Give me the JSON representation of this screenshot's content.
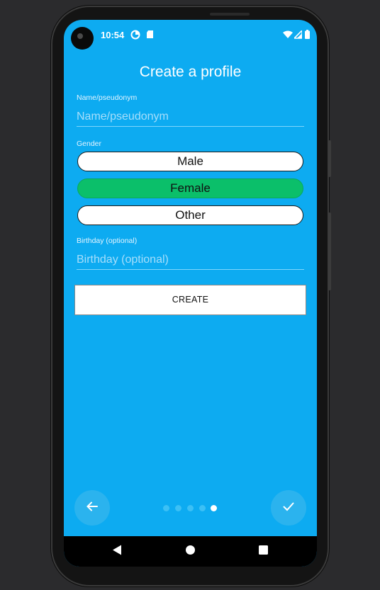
{
  "status_bar": {
    "time": "10:54",
    "icons": [
      "data-saver-icon",
      "sd-card-icon",
      "wifi-icon",
      "signal-icon",
      "battery-icon"
    ]
  },
  "screen": {
    "title": "Create a profile",
    "name_field": {
      "label": "Name/pseudonym",
      "placeholder": "Name/pseudonym",
      "value": ""
    },
    "gender": {
      "label": "Gender",
      "options": [
        {
          "label": "Male",
          "selected": false
        },
        {
          "label": "Female",
          "selected": true
        },
        {
          "label": "Other",
          "selected": false
        }
      ]
    },
    "birthday_field": {
      "label": "Birthday (optional)",
      "placeholder": "Birthday (optional)",
      "value": ""
    },
    "create_button": "CREATE"
  },
  "pager": {
    "page_count": 5,
    "current_page": 5,
    "back_icon": "arrow-left-icon",
    "done_icon": "checkmark-icon"
  },
  "system_nav": {
    "icons": [
      "back-triangle-icon",
      "home-circle-icon",
      "recents-square-icon"
    ]
  },
  "colors": {
    "screen_background": "#0dabf1",
    "selected_option": "#0bbf6a",
    "option_background": "#ffffff",
    "text_primary": "#ffffff"
  }
}
